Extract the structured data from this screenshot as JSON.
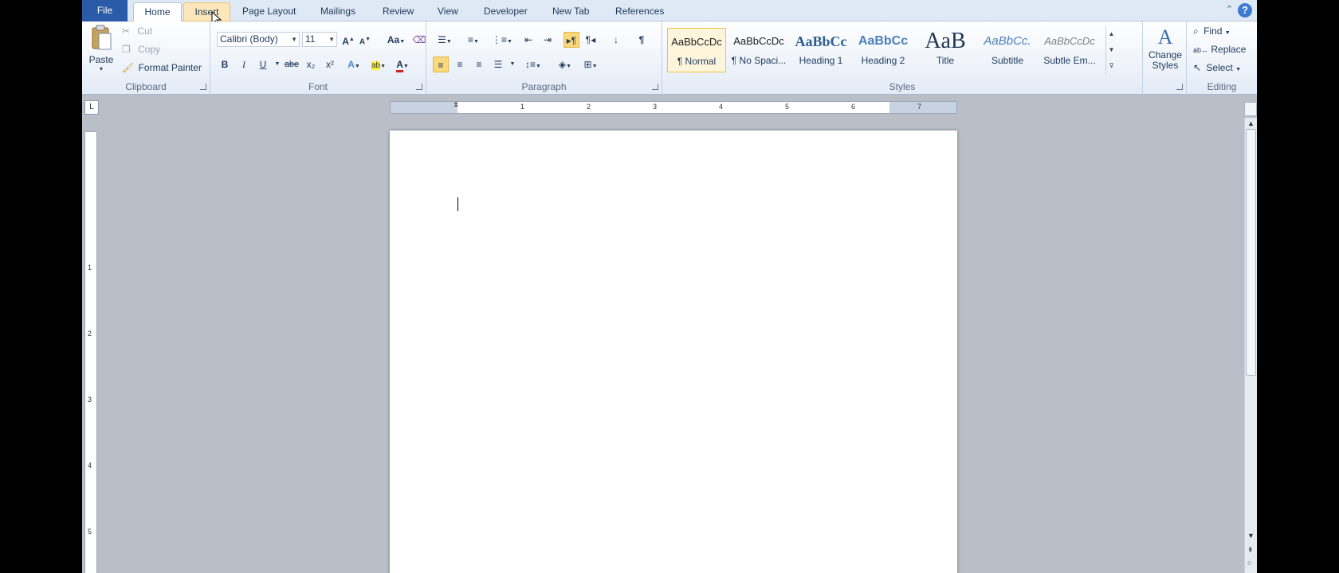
{
  "tabs": [
    {
      "label": "File",
      "type": "file"
    },
    {
      "label": "Home",
      "type": "active"
    },
    {
      "label": "Insert",
      "type": "hover"
    },
    {
      "label": "Page Layout",
      "type": ""
    },
    {
      "label": "Mailings",
      "type": ""
    },
    {
      "label": "Review",
      "type": ""
    },
    {
      "label": "View",
      "type": ""
    },
    {
      "label": "Developer",
      "type": ""
    },
    {
      "label": "New Tab",
      "type": ""
    },
    {
      "label": "References",
      "type": ""
    }
  ],
  "help_label": "?",
  "clipboard": {
    "label": "Clipboard",
    "paste": "Paste",
    "cut": "Cut",
    "copy": "Copy",
    "format_painter": "Format Painter"
  },
  "font": {
    "label": "Font",
    "family": "Calibri (Body)",
    "size": "11",
    "grow": "A",
    "shrink": "A",
    "change_case": "Aa",
    "bold": "B",
    "italic": "I",
    "underline": "U",
    "strike": "abe",
    "subscript": "x₂",
    "superscript": "x²",
    "font_color": "A"
  },
  "paragraph": {
    "label": "Paragraph",
    "pilcrow": "¶"
  },
  "styles": {
    "label": "Styles",
    "items": [
      {
        "preview": "AaBbCcDc",
        "name": "¶ Normal"
      },
      {
        "preview": "AaBbCcDc",
        "name": "¶ No Spaci..."
      },
      {
        "preview": "AaBbCc",
        "name": "Heading 1"
      },
      {
        "preview": "AaBbCc",
        "name": "Heading 2"
      },
      {
        "preview": "AaB",
        "name": "Title"
      },
      {
        "preview": "AaBbCc.",
        "name": "Subtitle"
      },
      {
        "preview": "AaBbCcDc",
        "name": "Subtle Em..."
      }
    ],
    "change_styles": "Change Styles"
  },
  "editing": {
    "label": "Editing",
    "find": "Find",
    "replace": "Replace",
    "select": "Select"
  },
  "ruler_numbers": [
    "1",
    "2",
    "3",
    "4",
    "5",
    "6",
    "7"
  ],
  "vruler_numbers": [
    "1",
    "2",
    "3",
    "4",
    "5"
  ],
  "ruler_corner": "L"
}
